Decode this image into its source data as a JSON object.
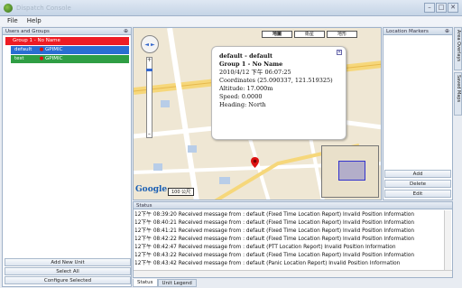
{
  "window": {
    "title": "Dispatch Console"
  },
  "menu": {
    "items": [
      "File",
      "Help"
    ]
  },
  "left_panel": {
    "header": "Users and Groups",
    "group": "Group 1 - No Name",
    "units": [
      {
        "name": "default",
        "source": "GPIMIC",
        "color": "#2a6ed1"
      },
      {
        "name": "test",
        "source": "GPIMIC",
        "color": "#2f9e44"
      }
    ],
    "buttons": {
      "add_unit": "Add New Unit",
      "select_all": "Select All",
      "configure": "Configure Selected"
    }
  },
  "map": {
    "types": [
      "地圖",
      "衛星",
      "地形"
    ],
    "selected_type": "地圖",
    "google_logo": "Google",
    "scale": "100 公尺",
    "popup": {
      "title": "default - default",
      "group": "Group 1 - No Name",
      "datetime": "2010/4/12 下午 06:07:25",
      "coordinates": "Coordinates (25.090337, 121.519325)",
      "altitude": "Altitude: 17.000m",
      "speed": "Speed: 0.0000",
      "heading": "Heading: North"
    }
  },
  "right_panel": {
    "header": "Location Markers",
    "buttons": {
      "add": "Add",
      "delete": "Delete",
      "edit": "Edit"
    }
  },
  "side_tabs": [
    "Area Overlays",
    "Saved Maps"
  ],
  "status_panel": {
    "header": "Status",
    "lines": [
      "12下午 08:39:20 Received message from : default (Fixed Time Location Report) Invalid Position Information",
      "12下午 08:40:21 Received message from : default (Fixed Time Location Report) Invalid Position Information",
      "12下午 08:41:21 Received message from : default (Fixed Time Location Report) Invalid Position Information",
      "12下午 08:42:22 Received message from : default (Fixed Time Location Report) Invalid Position Information",
      "12下午 08:42:47 Received message from : default (PTT Location Report) Invalid Position Information",
      "12下午 08:43:22 Received message from : default (Fixed Time Location Report) Invalid Position Information",
      "12下午 08:43:42 Received message from : default (Panic Location Report) Invalid Position Information"
    ]
  },
  "bottom_tabs": [
    "Status",
    "Unit Legend"
  ]
}
